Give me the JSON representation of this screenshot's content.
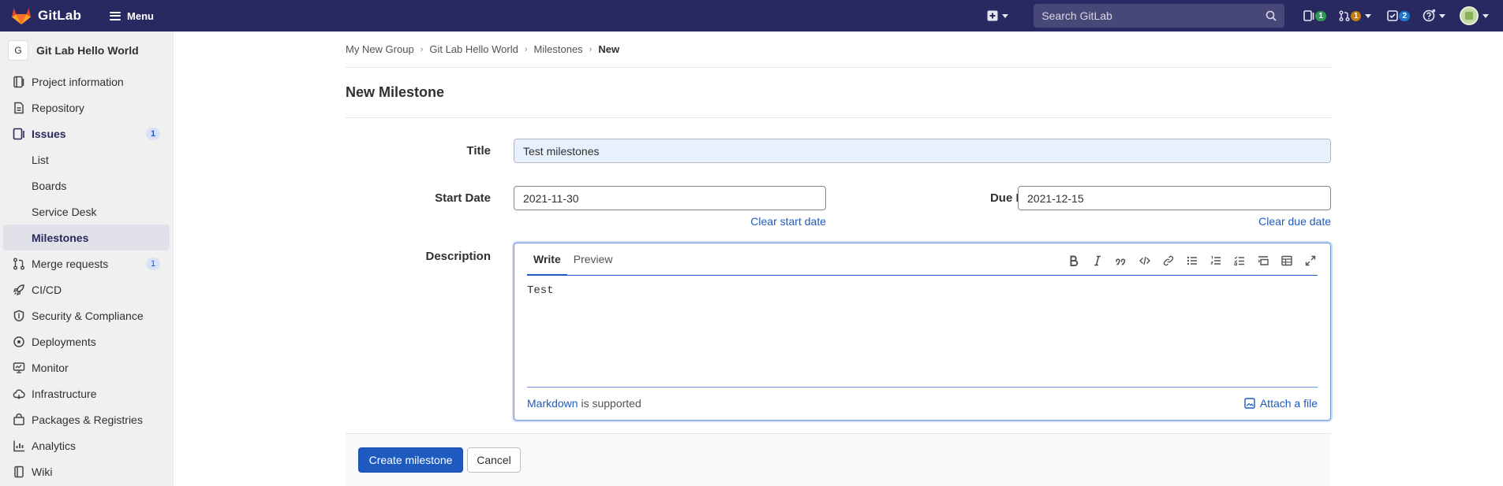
{
  "topbar": {
    "brand": "GitLab",
    "menu_label": "Menu",
    "search_placeholder": "Search GitLab",
    "issues_count": "1",
    "merge_requests_count": "1",
    "todos_count": "2",
    "colors": {
      "bg": "#292961",
      "issues_badge": "#2f9a55",
      "mr_badge": "#c17d10",
      "todos_badge": "#1f75cb"
    }
  },
  "sidebar": {
    "project_initial": "G",
    "project_name": "Git Lab Hello World",
    "items": [
      {
        "label": "Project information",
        "icon": "project-icon"
      },
      {
        "label": "Repository",
        "icon": "document-icon"
      },
      {
        "label": "Issues",
        "icon": "issues-icon",
        "badge": "1",
        "active": true
      },
      {
        "label": "List",
        "sub": true
      },
      {
        "label": "Boards",
        "sub": true
      },
      {
        "label": "Service Desk",
        "sub": true
      },
      {
        "label": "Milestones",
        "sub": true,
        "active": true
      },
      {
        "label": "Merge requests",
        "icon": "merge-request-icon",
        "badge": "1"
      },
      {
        "label": "CI/CD",
        "icon": "rocket-icon"
      },
      {
        "label": "Security & Compliance",
        "icon": "shield-icon"
      },
      {
        "label": "Deployments",
        "icon": "deployments-icon"
      },
      {
        "label": "Monitor",
        "icon": "monitor-icon"
      },
      {
        "label": "Infrastructure",
        "icon": "cloud-icon"
      },
      {
        "label": "Packages & Registries",
        "icon": "package-icon"
      },
      {
        "label": "Analytics",
        "icon": "chart-icon"
      },
      {
        "label": "Wiki",
        "icon": "book-icon"
      }
    ]
  },
  "breadcrumbs": [
    "My New Group",
    "Git Lab Hello World",
    "Milestones",
    "New"
  ],
  "page_title": "New Milestone",
  "form": {
    "title_label": "Title",
    "title_value": "Test milestones",
    "start_date_label": "Start Date",
    "start_date_value": "2021-11-30",
    "clear_start": "Clear start date",
    "due_date_label": "Due Date",
    "due_date_value": "2021-12-15",
    "clear_due": "Clear due date",
    "description_label": "Description",
    "tab_write": "Write",
    "tab_preview": "Preview",
    "description_value": "Test",
    "markdown_link": "Markdown",
    "markdown_suffix": " is supported",
    "attach_file": "Attach a file"
  },
  "actions": {
    "create": "Create milestone",
    "cancel": "Cancel"
  }
}
